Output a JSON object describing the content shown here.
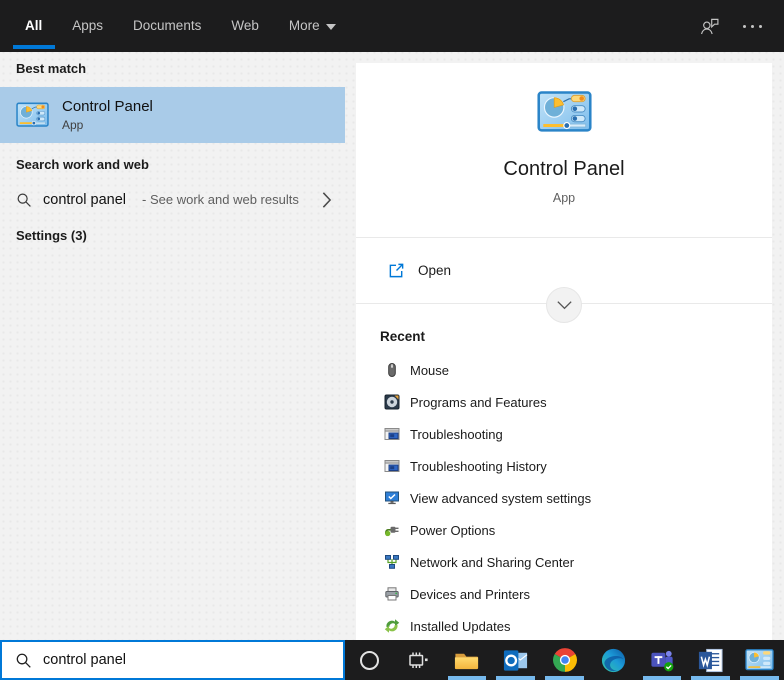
{
  "topbar": {
    "tabs": [
      {
        "label": "All",
        "active": true
      },
      {
        "label": "Apps",
        "active": false
      },
      {
        "label": "Documents",
        "active": false
      },
      {
        "label": "Web",
        "active": false
      },
      {
        "label": "More",
        "active": false,
        "has_dropdown": true
      }
    ],
    "icons": [
      {
        "name": "feedback-icon"
      },
      {
        "name": "ellipsis-icon"
      }
    ]
  },
  "left_panel": {
    "best_match": {
      "header": "Best match",
      "item": {
        "title": "Control Panel",
        "subtitle": "App",
        "icon": "control-panel-icon"
      }
    },
    "web_search": {
      "header": "Search work and web",
      "query": "control panel",
      "hint": "- See work and web results",
      "icon": "search-icon",
      "chevron": "chevron-right-icon"
    },
    "settings": {
      "header": "Settings (3)"
    }
  },
  "preview": {
    "icon": "control-panel-icon",
    "title": "Control Panel",
    "subtitle": "App",
    "actions": [
      {
        "label": "Open",
        "icon": "open-icon"
      }
    ],
    "expand_icon": "chevron-down-icon",
    "recent_header": "Recent",
    "recent": [
      {
        "label": "Mouse",
        "icon": "mouse-icon"
      },
      {
        "label": "Programs and Features",
        "icon": "programs-and-features-icon"
      },
      {
        "label": "Troubleshooting",
        "icon": "troubleshooting-icon"
      },
      {
        "label": "Troubleshooting History",
        "icon": "troubleshooting-history-icon"
      },
      {
        "label": "View advanced system settings",
        "icon": "advanced-system-settings-icon"
      },
      {
        "label": "Power Options",
        "icon": "power-options-icon"
      },
      {
        "label": "Network and Sharing Center",
        "icon": "network-sharing-center-icon"
      },
      {
        "label": "Devices and Printers",
        "icon": "devices-and-printers-icon"
      },
      {
        "label": "Installed Updates",
        "icon": "installed-updates-icon"
      }
    ]
  },
  "search_box": {
    "value": "control panel",
    "icon": "search-icon"
  },
  "taskbar": {
    "apps": [
      {
        "name": "cortana",
        "running": false
      },
      {
        "name": "task-view",
        "running": false
      },
      {
        "name": "file-explorer",
        "running": true
      },
      {
        "name": "outlook",
        "running": true
      },
      {
        "name": "chrome",
        "running": true
      },
      {
        "name": "edge",
        "running": false
      },
      {
        "name": "teams",
        "running": true
      },
      {
        "name": "word",
        "running": true
      },
      {
        "name": "control-panel",
        "running": true
      }
    ]
  },
  "colors": {
    "accent": "#0078d7",
    "taskbar-bg": "#1c1c1d",
    "highlight": "#a9cbe8",
    "indicator": "#76b9ed",
    "card-bg": "#ffffff",
    "panel-bg": "#f2f2f2",
    "text": "#1b1b1b",
    "muted": "#5f5f5f"
  }
}
